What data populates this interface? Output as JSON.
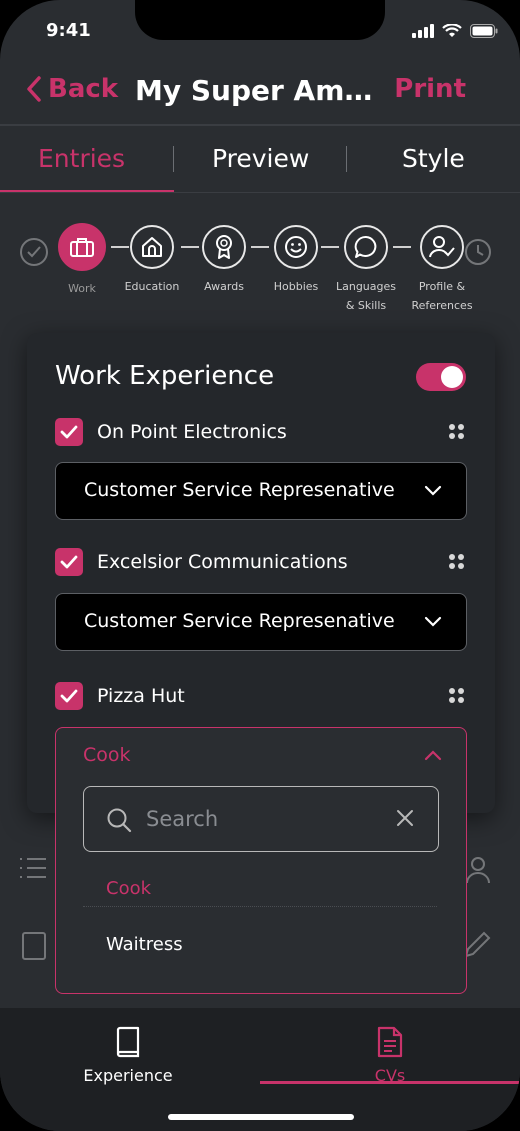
{
  "status": {
    "time": "9:41"
  },
  "nav": {
    "back_label": "Back",
    "title": "My Super Amazing CV",
    "print_label": "Print"
  },
  "tabs": [
    "Entries",
    "Preview",
    "Style"
  ],
  "steps": [
    {
      "label": "Work",
      "icon": "briefcase-icon"
    },
    {
      "label": "Education",
      "icon": "school-icon"
    },
    {
      "label": "Awards",
      "icon": "award-icon"
    },
    {
      "label": "Hobbies",
      "icon": "smiley-icon"
    },
    {
      "label_line1": "Languages",
      "label_line2": "& Skills",
      "icon": "chat-bubble-icon"
    },
    {
      "label_line1": "Profile &",
      "label_line2": "References",
      "icon": "user-check-icon"
    }
  ],
  "work": {
    "title": "Work Experience",
    "enabled": true,
    "entries": [
      {
        "company": "On Point Electronics",
        "checked": true,
        "role": "Customer Service Represenative"
      },
      {
        "company": "Excelsior Communications",
        "checked": true,
        "role": "Customer Service Represenative"
      },
      {
        "company": "Pizza Hut",
        "checked": true,
        "role": "Cook"
      }
    ],
    "dropdown": {
      "selected": "Cook",
      "search_placeholder": "Search",
      "options": [
        "Cook",
        "Waitress"
      ]
    }
  },
  "bottom_nav": [
    {
      "label": "Experience",
      "icon": "book-icon",
      "active": false
    },
    {
      "label": "CVs",
      "icon": "document-icon",
      "active": true
    }
  ],
  "colors": {
    "accent": "#c8336a",
    "background": "#2a2d31",
    "card": "#24272b"
  }
}
